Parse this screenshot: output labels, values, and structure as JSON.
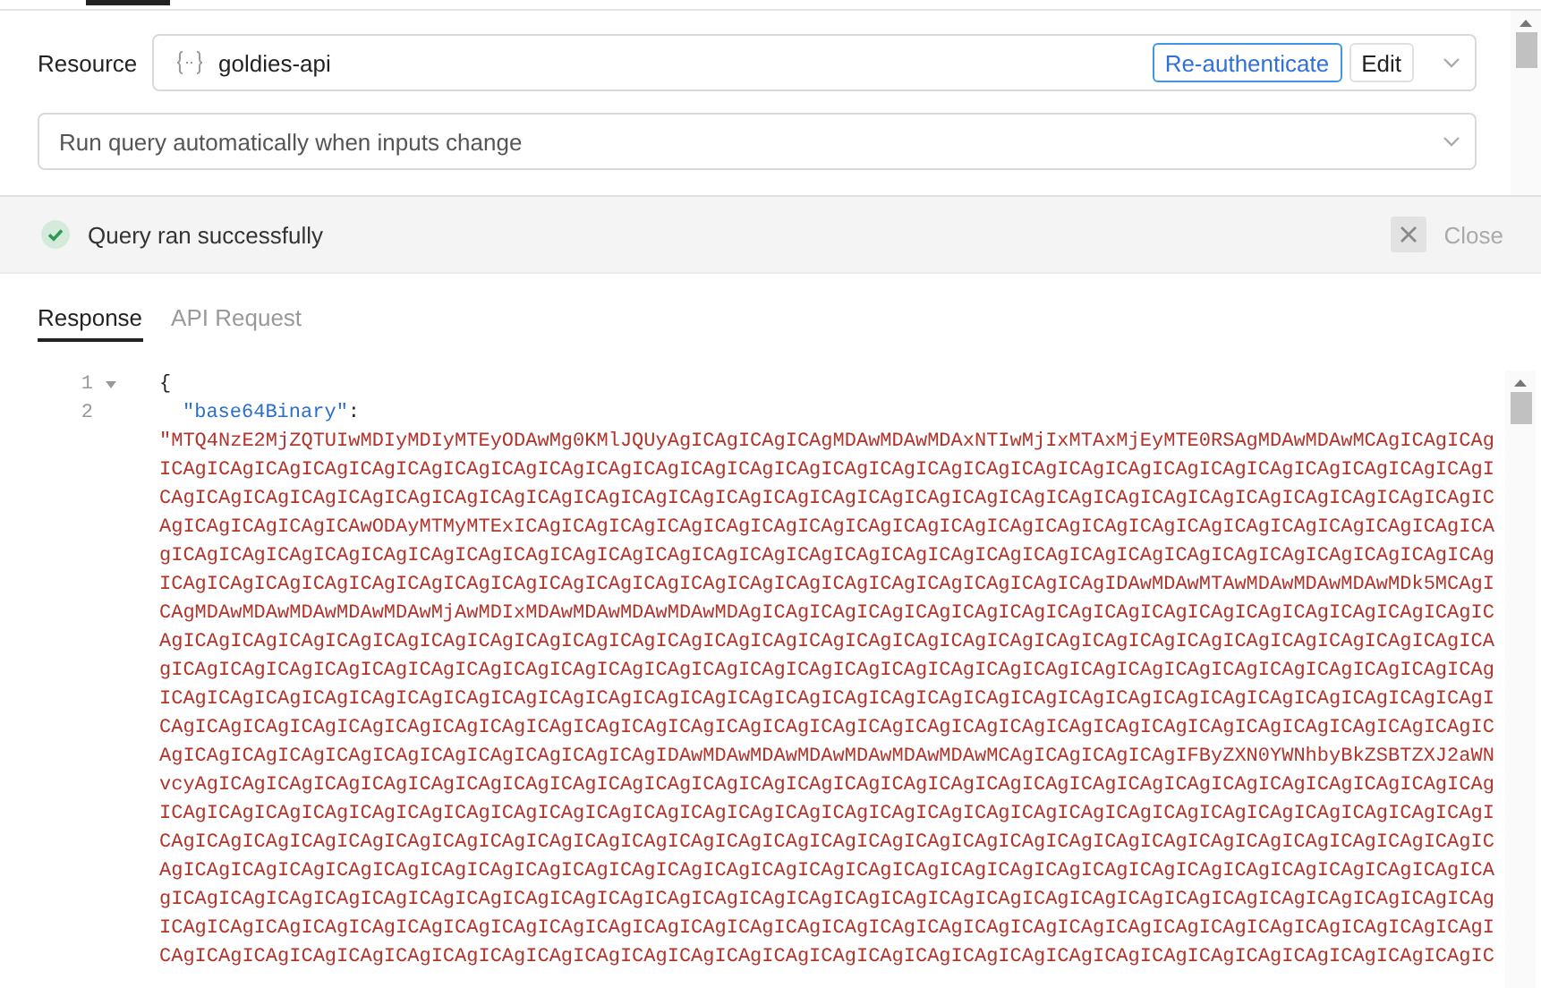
{
  "resource": {
    "label": "Resource",
    "value": "goldies-api",
    "buttons": [
      "Re-authenticate",
      "Edit"
    ]
  },
  "trigger_select": {
    "value": "Run query automatically when inputs change"
  },
  "status": {
    "message": "Query ran successfully",
    "close": "Close"
  },
  "tabs": [
    {
      "label": "Response",
      "selected": true
    },
    {
      "label": "API Request",
      "selected": false
    }
  ],
  "editor": {
    "lines": [
      {
        "number": "1",
        "foldable": true,
        "text": "{"
      },
      {
        "number": "2",
        "foldable": false,
        "key": "\"base64Binary\"",
        "separator": ":",
        "value_rows": [
          "\"MTQ4NzE2MjZQTUIwMDIyMDIyMTEyODAwMg0KMlJQUyAgICAgICAgICAgMDAwMDAwMDAxNTIwMjIxMTAxMjEyMTE0RSAgMDAwMDAwMCAgICAgICAg",
          "ICAgICAgICAgICAgICAgICAgICAgICAgICAgICAgICAgICAgICAgICAgICAgICAgICAgICAgICAgICAgICAgICAgICAgICAgICAgICAgICAgICAgI",
          "CAgICAgICAgICAgICAgICAgICAgICAgICAgICAgICAgICAgICAgICAgICAgICAgICAgICAgICAgICAgICAgICAgICAgICAgICAgICAgICAgICAgIC",
          "AgICAgICAgICAgICAwODAyMTMyMTExICAgICAgICAgICAgICAgICAgICAgICAgICAgICAgICAgICAgICAgICAgICAgICAgICAgICAgICAgICAgICA",
          "gICAgICAgICAgICAgICAgICAgICAgICAgICAgICAgICAgICAgICAgICAgICAgICAgICAgICAgICAgICAgICAgICAgICAgICAgICAgICAgICAgICAg",
          "ICAgICAgICAgICAgICAgICAgICAgICAgICAgICAgICAgICAgICAgICAgICAgICAgICAgICAgICAgICAgIDAwMDAwMTAwMDAwMDAwMDAwMDk5MCAgI",
          "CAgMDAwMDAwMDAwMDAwMDAwMjAwMDIxMDAwMDAwMDAwMDAwMDAgICAgICAgICAgICAgICAgICAgICAgICAgICAgICAgICAgICAgICAgICAgICAgIC",
          "AgICAgICAgICAgICAgICAgICAgICAgICAgICAgICAgICAgICAgICAgICAgICAgICAgICAgICAgICAgICAgICAgICAgICAgICAgICAgICAgICAgICA",
          "gICAgICAgICAgICAgICAgICAgICAgICAgICAgICAgICAgICAgICAgICAgICAgICAgICAgICAgICAgICAgICAgICAgICAgICAgICAgICAgICAgICAg",
          "ICAgICAgICAgICAgICAgICAgICAgICAgICAgICAgICAgICAgICAgICAgICAgICAgICAgICAgICAgICAgICAgICAgICAgICAgICAgICAgICAgICAgI",
          "CAgICAgICAgICAgICAgICAgICAgICAgICAgICAgICAgICAgICAgICAgICAgICAgICAgICAgICAgICAgICAgICAgICAgICAgICAgICAgICAgICAgIC",
          "AgICAgICAgICAgICAgICAgICAgICAgICAgICAgICAgIDAwMDAwMDAwMDAwMDAwMDAwMDAwMCAgICAgICAgICAgIFByZXN0YWNhbyBkZSBTZXJ2aWN",
          "vcyAgICAgICAgICAgICAgICAgICAgICAgICAgICAgICAgICAgICAgICAgICAgICAgICAgICAgICAgICAgICAgICAgICAgICAgICAgICAgICAgICAg",
          "ICAgICAgICAgICAgICAgICAgICAgICAgICAgICAgICAgICAgICAgICAgICAgICAgICAgICAgICAgICAgICAgICAgICAgICAgICAgICAgICAgICAgI",
          "CAgICAgICAgICAgICAgICAgICAgICAgICAgICAgICAgICAgICAgICAgICAgICAgICAgICAgICAgICAgICAgICAgICAgICAgICAgICAgICAgICAgIC",
          "AgICAgICAgICAgICAgICAgICAgICAgICAgICAgICAgICAgICAgICAgICAgICAgICAgICAgICAgICAgICAgICAgICAgICAgICAgICAgICAgICAgICA",
          "gICAgICAgICAgICAgICAgICAgICAgICAgICAgICAgICAgICAgICAgICAgICAgICAgICAgICAgICAgICAgICAgICAgICAgICAgICAgICAgICAgICAg",
          "ICAgICAgICAgICAgICAgICAgICAgICAgICAgICAgICAgICAgICAgICAgICAgICAgICAgICAgICAgICAgICAgICAgICAgICAgICAgICAgICAgICAgI",
          "CAgICAgICAgICAgICAgICAgICAgICAgICAgICAgICAgICAgICAgICAgICAgICAgICAgICAgICAgICAgICAgICAgICAgICAgICAgICAgICAgICAgIC"
        ]
      }
    ]
  }
}
